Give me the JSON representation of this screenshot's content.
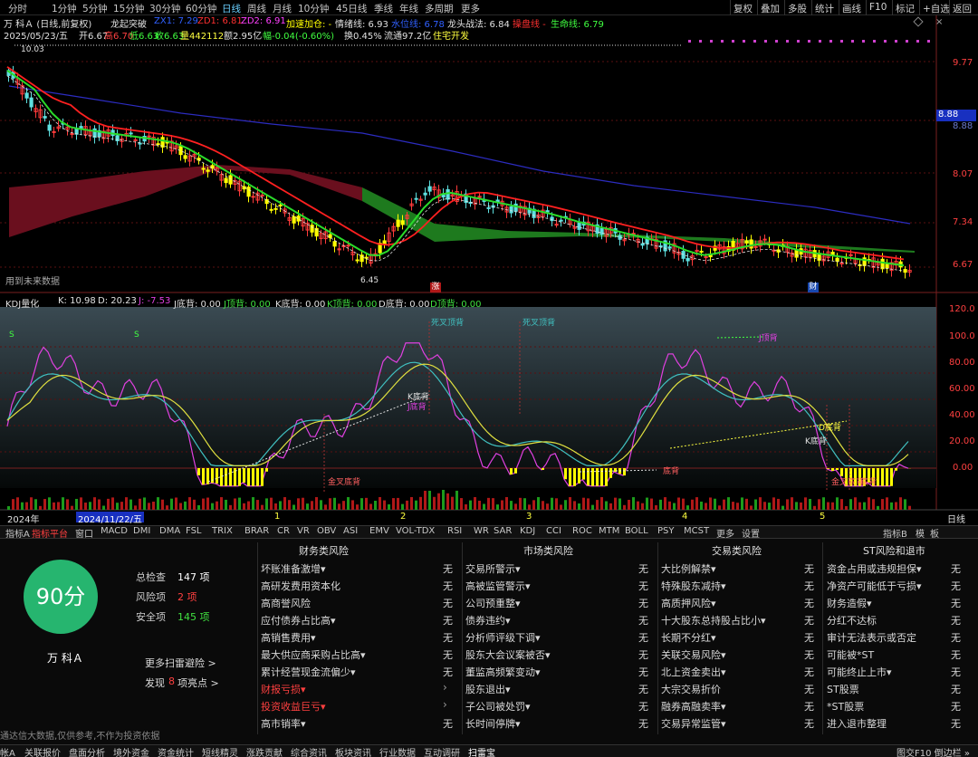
{
  "topbar": {
    "tabs": [
      "分时",
      "1分钟",
      "5分钟",
      "15分钟",
      "30分钟",
      "60分钟",
      "日线",
      "周线",
      "月线",
      "10分钟",
      "45日线",
      "季线",
      "年线",
      "多周期",
      "更多"
    ],
    "active_tab": "日线",
    "right_buttons": [
      "复权",
      "叠加",
      "多股",
      "统计",
      "画线",
      "F10",
      "标记",
      "+自选",
      "返回"
    ]
  },
  "header": {
    "line1_title": "万 科Ａ (日线,前复权)",
    "line1_formula": "龙起突破",
    "zx1": "ZX1: 7.29",
    "zd1": "ZD1: 6.81",
    "zd2": "ZD2: 6.91",
    "jiasu": "加速加仓: -",
    "qingxu": "情绪线: 6.93",
    "shuiwei": "水位线: 6.78",
    "longtou": "龙头战法: 6.84",
    "caopan": "操盘线 -",
    "shengming": "生命线: 6.79",
    "line2_date": "2025/05/23/五",
    "line2_open": "开6.67",
    "line2_high": "高6.70",
    "line2_low": "低6.63",
    "line2_close": "收6.63",
    "line2_vol": "量442112",
    "line2_amt": "额2.95亿",
    "line2_chg": "幅-0.04(-0.60%)",
    "line2_turn": "换0.45%",
    "line2_float": "流通97.2亿",
    "line2_ind": "住宅开发"
  },
  "price_axis": [
    "9.77",
    "8.88",
    "8.07",
    "7.34",
    "6.67"
  ],
  "price_marks": {
    "high": "10.03",
    "low": "6.45",
    "current": "8.88"
  },
  "future_label": "用到未来数据",
  "kdj_header": {
    "name": "KDJ量化",
    "k": "K: 10.98",
    "d": "D: 20.23",
    "j": "J: -7.53",
    "jdb": "J底背: 0.00",
    "jdf": "J顶背: 0.00",
    "kdb": "K底背: 0.00",
    "kdf": "K顶背: 0.00",
    "ddb": "D底背: 0.00",
    "ddf": "D顶背: 0.00"
  },
  "kdj_axis": [
    "120.0",
    "100.0",
    "80.00",
    "60.00",
    "40.00",
    "20.00",
    "0.00"
  ],
  "kdj_labels": {
    "s1": "S",
    "s2": "S",
    "sicha1": "死叉顶背",
    "sicha2": "死叉顶背",
    "kdi1": "K底背",
    "jdi1": "J底背",
    "jindi1": "金叉底背",
    "jding": "J顶背",
    "ddi": "D底背",
    "kdi2": "K底背",
    "jindi2": "金叉底背",
    "dibei": "底背",
    "zhang": "涨",
    "cai": "财"
  },
  "date_axis": {
    "year": "2024年",
    "highlight": "2024/11/22/五",
    "months": [
      "1",
      "2",
      "3",
      "4",
      "5"
    ],
    "right": "日线"
  },
  "indicator_bar": [
    "指标A",
    "指标平台",
    "窗口",
    "MACD",
    "DMI",
    "DMA",
    "FSL",
    "TRIX",
    "BRAR",
    "CR",
    "VR",
    "OBV",
    "ASI",
    "EMV",
    "VOL-TDX",
    "RSI",
    "WR",
    "SAR",
    "KDJ",
    "CCI",
    "ROC",
    "MTM",
    "BOLL",
    "PSY",
    "MCST",
    "更多",
    "设置"
  ],
  "indicator_bar_right": [
    "指标B",
    "模",
    "板"
  ],
  "panel": {
    "score": "90分",
    "total_label": "总检查",
    "total_value": "147 项",
    "risk_label": "风险项",
    "risk_value": "2 项",
    "safe_label": "安全项",
    "safe_value": "145 项",
    "stock_name": "万 科Ａ",
    "more_link": "更多扫雷避险 >",
    "found_prefix": "发现",
    "found_count": "8",
    "found_suffix": "项亮点 >",
    "disclaimer": "通达信大数据,仅供参考,不作为投资依据",
    "none": "无",
    "cols": [
      {
        "title": "财务类风险",
        "rows": [
          {
            "label": "坏账准备激增▾",
            "red": false
          },
          {
            "label": "高研发费用资本化",
            "red": false
          },
          {
            "label": "高商誉风险",
            "red": false
          },
          {
            "label": "应付债券占比高▾",
            "red": false
          },
          {
            "label": "高销售费用▾",
            "red": false
          },
          {
            "label": "最大供应商采购占比高▾",
            "red": false
          },
          {
            "label": "累计经营现金流偏少▾",
            "red": false
          },
          {
            "label": "财报亏损▾",
            "red": true
          },
          {
            "label": "投资收益巨亏▾",
            "red": true
          },
          {
            "label": "高市销率▾",
            "red": false
          }
        ]
      },
      {
        "title": "市场类风险",
        "rows": [
          {
            "label": "交易所警示▾",
            "red": false
          },
          {
            "label": "高被监管警示▾",
            "red": false
          },
          {
            "label": "公司预重整▾",
            "red": false
          },
          {
            "label": "债券违约▾",
            "red": false
          },
          {
            "label": "分析师评级下调▾",
            "red": false
          },
          {
            "label": "股东大会议案被否▾",
            "red": false
          },
          {
            "label": "董监高频繁变动▾",
            "red": false
          },
          {
            "label": "股东退出▾",
            "red": false
          },
          {
            "label": "子公司被处罚▾",
            "red": false
          },
          {
            "label": "长时间停牌▾",
            "red": false
          }
        ]
      },
      {
        "title": "交易类风险",
        "rows": [
          {
            "label": "大比例解禁▾",
            "red": false
          },
          {
            "label": "特殊股东减持▾",
            "red": false
          },
          {
            "label": "高质押风险▾",
            "red": false
          },
          {
            "label": "十大股东总持股占比小▾",
            "red": false
          },
          {
            "label": "长期不分红▾",
            "red": false
          },
          {
            "label": "关联交易风险▾",
            "red": false
          },
          {
            "label": "北上资金卖出▾",
            "red": false
          },
          {
            "label": "大宗交易折价",
            "red": false
          },
          {
            "label": "融券高融卖率▾",
            "red": false
          },
          {
            "label": "交易异常监管▾",
            "red": false
          }
        ]
      },
      {
        "title": "ST风险和退市",
        "rows": [
          {
            "label": "资金占用或违规担保▾",
            "red": false
          },
          {
            "label": "净资产可能低于亏损▾",
            "red": false
          },
          {
            "label": "财务造假▾",
            "red": false
          },
          {
            "label": "分红不达标",
            "red": false
          },
          {
            "label": "审计无法表示或否定",
            "red": false
          },
          {
            "label": "可能被*ST",
            "red": false
          },
          {
            "label": "可能终止上市▾",
            "red": false
          },
          {
            "label": "ST股票",
            "red": false
          },
          {
            "label": "*ST股票",
            "red": false
          },
          {
            "label": "进入退市整理",
            "red": false
          }
        ]
      }
    ]
  },
  "bottombar": [
    "帐A",
    "关联报价",
    "盘面分析",
    "境外资金",
    "资金统计",
    "短线精灵",
    "涨跌贡献",
    "综合资讯",
    "板块资讯",
    "行业数据",
    "互动调研",
    "扫雷宝"
  ],
  "bottombar_right": "图交F10 倒边栏 »",
  "colors": {
    "up": "#ff3b3b",
    "down": "#5ee0e0",
    "yellow": "#ffff00",
    "green": "#2adb2a",
    "kline": "#e040e0",
    "dline": "#40c0c0",
    "jline": "#e0e040",
    "score": "#26b56f"
  }
}
